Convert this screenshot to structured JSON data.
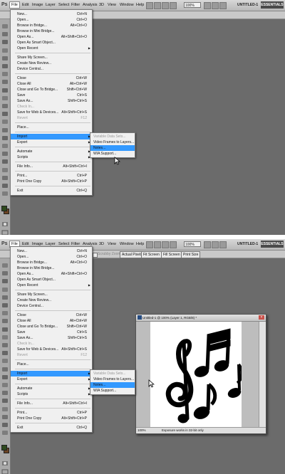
{
  "menubar": {
    "logo": "Ps",
    "items": [
      "File",
      "Edit",
      "Image",
      "Layer",
      "Select",
      "Filter",
      "Analysis",
      "3D",
      "View",
      "Window",
      "Help"
    ],
    "zoom": "100%",
    "doc_title": "UNTITLED-1",
    "workspace": "ESSENTIALS"
  },
  "options_bar": {
    "scrub_label": "Scrubby Zoom",
    "buttons": [
      "Actual Pixels",
      "Fit Screen",
      "Fill Screen",
      "Print Size"
    ]
  },
  "file_menu": [
    {
      "label": "New...",
      "shortcut": "Ctrl+N"
    },
    {
      "label": "Open...",
      "shortcut": "Ctrl+O"
    },
    {
      "label": "Browse in Bridge...",
      "shortcut": "Alt+Ctrl+O"
    },
    {
      "label": "Browse in Mini Bridge...",
      "shortcut": ""
    },
    {
      "label": "Open As...",
      "shortcut": "Alt+Shift+Ctrl+O"
    },
    {
      "label": "Open As Smart Object...",
      "shortcut": ""
    },
    {
      "label": "Open Recent",
      "shortcut": "",
      "submenu": true
    },
    {
      "separator": true
    },
    {
      "label": "Share My Screen...",
      "shortcut": ""
    },
    {
      "label": "Create New Review...",
      "shortcut": ""
    },
    {
      "label": "Device Central...",
      "shortcut": ""
    },
    {
      "separator": true
    },
    {
      "label": "Close",
      "shortcut": "Ctrl+W"
    },
    {
      "label": "Close All",
      "shortcut": "Alt+Ctrl+W"
    },
    {
      "label": "Close and Go To Bridge...",
      "shortcut": "Shift+Ctrl+W"
    },
    {
      "label": "Save",
      "shortcut": "Ctrl+S"
    },
    {
      "label": "Save As...",
      "shortcut": "Shift+Ctrl+S"
    },
    {
      "label": "Check In...",
      "shortcut": "",
      "disabled": true
    },
    {
      "label": "Save for Web & Devices...",
      "shortcut": "Alt+Shift+Ctrl+S"
    },
    {
      "label": "Revert",
      "shortcut": "F12",
      "disabled": true
    },
    {
      "separator": true
    },
    {
      "label": "Place...",
      "shortcut": ""
    },
    {
      "separator": true
    },
    {
      "label": "Import",
      "shortcut": "",
      "submenu": true,
      "selected": true
    },
    {
      "label": "Export",
      "shortcut": "",
      "submenu": true
    },
    {
      "separator": true
    },
    {
      "label": "Automate",
      "shortcut": "",
      "submenu": true
    },
    {
      "label": "Scripts",
      "shortcut": "",
      "submenu": true
    },
    {
      "separator": true
    },
    {
      "label": "File Info...",
      "shortcut": "Alt+Shift+Ctrl+I"
    },
    {
      "separator": true
    },
    {
      "label": "Print...",
      "shortcut": "Ctrl+P"
    },
    {
      "label": "Print One Copy",
      "shortcut": "Alt+Shift+Ctrl+P"
    },
    {
      "separator": true
    },
    {
      "label": "Exit",
      "shortcut": "Ctrl+Q"
    }
  ],
  "import_submenu": [
    {
      "label": "Variable Data Sets...",
      "disabled": true
    },
    {
      "label": "Video Frames to Layers...",
      "disabled": false
    },
    {
      "label": "Notes...",
      "disabled": false,
      "selected": true
    },
    {
      "label": "WIA Support...",
      "disabled": false
    }
  ],
  "document": {
    "title": "Untitled-1 @ 100% (Layer 1, RGB/8) *",
    "zoom": "100%",
    "status": "Exposure works in 32-bit only"
  }
}
